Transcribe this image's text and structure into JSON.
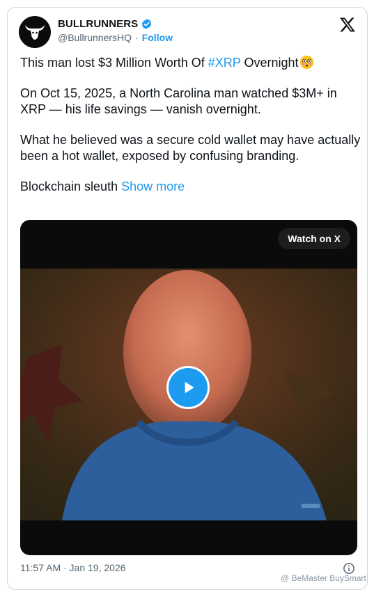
{
  "account": {
    "name": "BULLRUNNERS",
    "handle": "@BullrunnersHQ",
    "separator": "·",
    "follow_label": "Follow"
  },
  "tweet": {
    "p1_text": "This man lost $3 Million Worth Of ",
    "p1_hashtag": "#XRP",
    "p1_tail": " Overnight",
    "p2": "On Oct 15, 2025, a North Carolina man watched $3M+ in XRP — his life savings — vanish overnight.",
    "p3": "What he believed was a secure cold wallet may have actually been a hot wallet, exposed by confusing branding.",
    "p4_text": "Blockchain sleuth ",
    "show_more": "Show more"
  },
  "media": {
    "watch_label": "Watch on X"
  },
  "footer": {
    "timestamp": "11:57 AM · Jan 19, 2026",
    "watermark": "@ BeMaster BuySmart"
  },
  "colors": {
    "link": "#1d9bf0",
    "secondary_text": "#536471",
    "border": "#cfd9de"
  },
  "icons": [
    "bull-logo-icon",
    "verified-badge-icon",
    "x-logo-icon",
    "flushed-face-emoji-icon",
    "play-icon",
    "info-icon"
  ]
}
